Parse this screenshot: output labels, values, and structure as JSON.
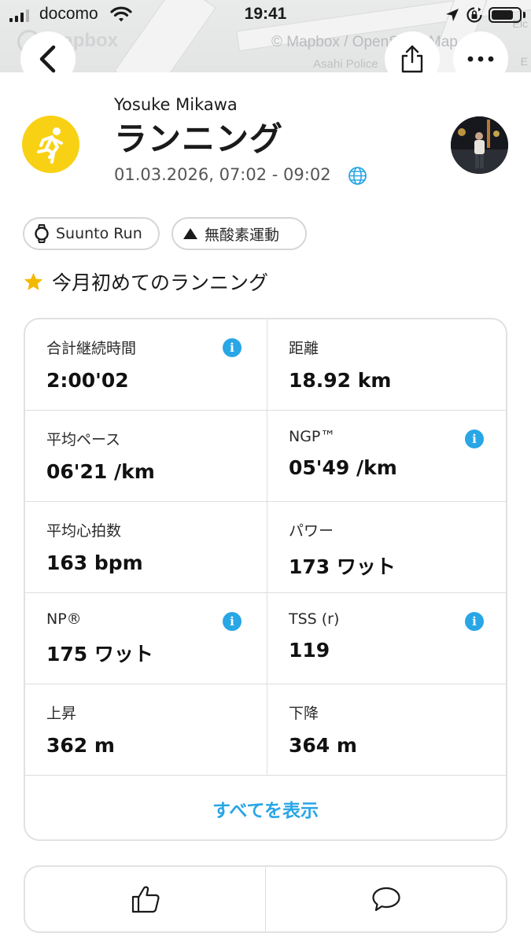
{
  "status_bar": {
    "carrier": "docomo",
    "time": "19:41",
    "battery_level": 0.8
  },
  "map": {
    "attribution": "© Mapbox / OpenStreetMap",
    "place_label": "Asahi Police",
    "logo_text": "mapbox",
    "edge_label_1": "Elc",
    "edge_label_2": "E"
  },
  "header": {
    "user_name": "Yosuke Mikawa",
    "activity_type": "ランニング",
    "datetime": "01.03.2026, 07:02 - 09:02",
    "activity_icon": "running-person-icon",
    "accent_color": "#f8d115"
  },
  "chips": {
    "device": "Suunto Run",
    "training_effect": "無酸素運動"
  },
  "highlight": "今月初めてのランニング",
  "stats": [
    {
      "label": "合計継続時間",
      "value": "2:00'02",
      "info": true
    },
    {
      "label": "距離",
      "value": "18.92 km",
      "info": false
    },
    {
      "label": "平均ペース",
      "value": "06'21 /km",
      "info": false
    },
    {
      "label": "NGP™",
      "value": "05'49 /km",
      "info": true
    },
    {
      "label": "平均心拍数",
      "value": "163 bpm",
      "info": false
    },
    {
      "label": "パワー",
      "value": "173 ワット",
      "info": false
    },
    {
      "label": "NP®",
      "value": "175 ワット",
      "info": true
    },
    {
      "label": "TSS (r)",
      "value": "119",
      "info": true
    },
    {
      "label": "上昇",
      "value": "362 m",
      "info": false
    },
    {
      "label": "下降",
      "value": "364 m",
      "info": false
    }
  ],
  "show_all_label": "すべてを表示",
  "info_glyph": "i",
  "colors": {
    "link": "#28a6e6",
    "star": "#f5b800"
  }
}
